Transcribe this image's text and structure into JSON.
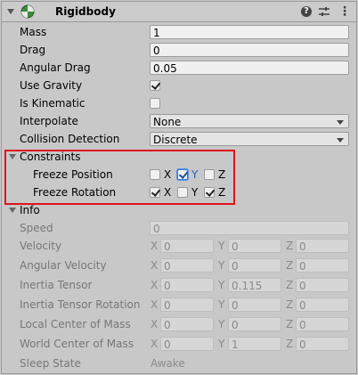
{
  "header": {
    "title": "Rigidbody"
  },
  "colors": {
    "highlight_box": "#e0141c",
    "accent": "#2c63c4"
  },
  "icons": {
    "component": "rigidbody-icon",
    "help": "help-icon",
    "presets": "presets-icon",
    "more": "more-options-icon"
  },
  "props": {
    "mass": {
      "label": "Mass",
      "value": "1"
    },
    "drag": {
      "label": "Drag",
      "value": "0"
    },
    "angular_drag": {
      "label": "Angular Drag",
      "value": "0.05"
    },
    "use_gravity": {
      "label": "Use Gravity",
      "checked": true
    },
    "is_kinematic": {
      "label": "Is Kinematic",
      "checked": false
    },
    "interpolate": {
      "label": "Interpolate",
      "value": "None"
    },
    "collision_detection": {
      "label": "Collision Detection",
      "value": "Discrete"
    }
  },
  "constraints": {
    "label": "Constraints",
    "freeze_position": {
      "label": "Freeze Position",
      "x": false,
      "y": true,
      "z": false
    },
    "freeze_rotation": {
      "label": "Freeze Rotation",
      "x": true,
      "y": false,
      "z": true
    },
    "axes": {
      "x": "X",
      "y": "Y",
      "z": "Z"
    }
  },
  "info": {
    "label": "Info",
    "speed": {
      "label": "Speed",
      "value": "0"
    },
    "velocity": {
      "label": "Velocity",
      "x": "0",
      "y": "0",
      "z": "0"
    },
    "angular_velocity": {
      "label": "Angular Velocity",
      "x": "0",
      "y": "0",
      "z": "0"
    },
    "inertia_tensor": {
      "label": "Inertia Tensor",
      "x": "0",
      "y": "0.115",
      "z": "0"
    },
    "inertia_tensor_rotation": {
      "label": "Inertia Tensor Rotation",
      "x": "0",
      "y": "0",
      "z": "0"
    },
    "local_center_of_mass": {
      "label": "Local Center of Mass",
      "x": "0",
      "y": "0",
      "z": "0"
    },
    "world_center_of_mass": {
      "label": "World Center of Mass",
      "x": "0",
      "y": "1",
      "z": "0"
    },
    "sleep_state": {
      "label": "Sleep State",
      "value": "Awake"
    }
  }
}
